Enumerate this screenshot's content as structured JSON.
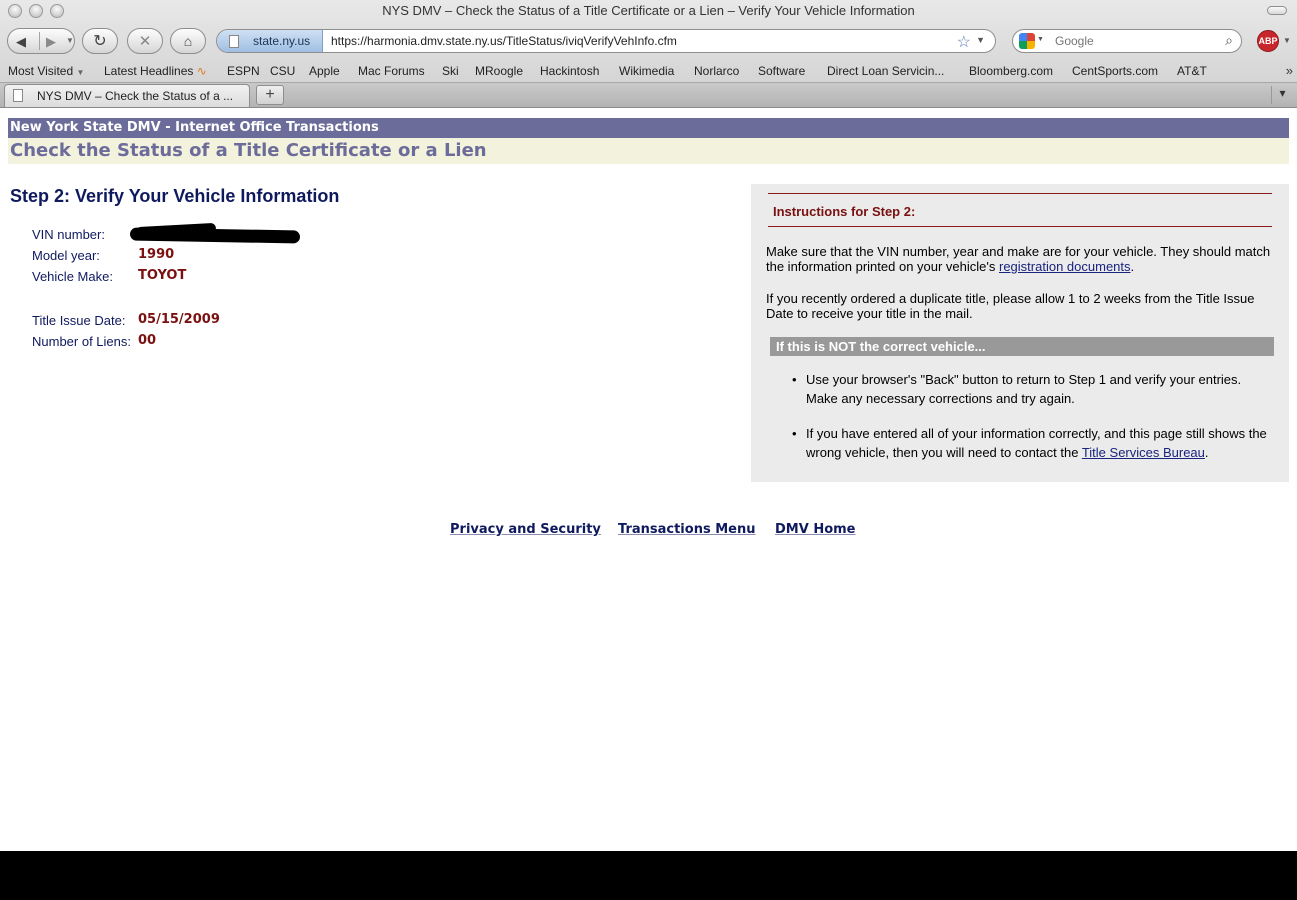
{
  "browser": {
    "window_title": "NYS DMV – Check the Status of a Title Certificate or a Lien – Verify Your Vehicle Information",
    "site_identity": "state.ny.us",
    "url": "https://harmonia.dmv.state.ny.us/TitleStatus/iviqVerifyVehInfo.cfm",
    "search_placeholder": "Google",
    "adblock_label": "ABP",
    "bookmarks": [
      "Most Visited",
      "Latest Headlines",
      "ESPN",
      "CSU",
      "Apple",
      "Mac Forums",
      "Ski",
      "MRoogle",
      "Hackintosh",
      "Wikimedia",
      "Norlarco",
      "Software",
      "Direct Loan Servicin...",
      "Bloomberg.com",
      "CentSports.com",
      "AT&T"
    ],
    "tab_label": "NYS DMV – Check the Status of a ...",
    "new_tab_label": "+"
  },
  "page": {
    "header": "New York State DMV - Internet Office Transactions",
    "heading": "Check the Status of a Title Certificate or a Lien",
    "step_title": "Step 2: Verify Your Vehicle Information",
    "vehicle": {
      "vin_label": "VIN number:",
      "model_year_label": "Model year:",
      "model_year": "1990",
      "make_label": "Vehicle Make:",
      "make": "TOYOT",
      "title_issue_label": "Title Issue Date:",
      "title_issue_date": "05/15/2009",
      "liens_label": "Number of Liens:",
      "liens": "00"
    },
    "instructions": {
      "title": "Instructions for Step 2:",
      "p1_before": "Make sure that the VIN number, year and make are for your vehicle. They should match the information printed on your vehicle's ",
      "p1_link": "registration documents",
      "p1_after": ".",
      "p2": "If you recently ordered a duplicate title, please allow 1 to 2 weeks from the Title Issue Date to receive your title in the mail.",
      "not_correct": "If this is NOT the correct vehicle...",
      "bullet1": "Use your browser's \"Back\" button to return to Step 1 and verify your entries. Make any necessary corrections and try again.",
      "bullet2_before": "If you have entered all of your information correctly, and this page still shows the wrong vehicle, then you will need to contact the ",
      "bullet2_link": "Title Services Bureau",
      "bullet2_after": "."
    },
    "footer": {
      "privacy": "Privacy and Security",
      "transactions": "Transactions Menu",
      "home": "DMV Home"
    }
  }
}
